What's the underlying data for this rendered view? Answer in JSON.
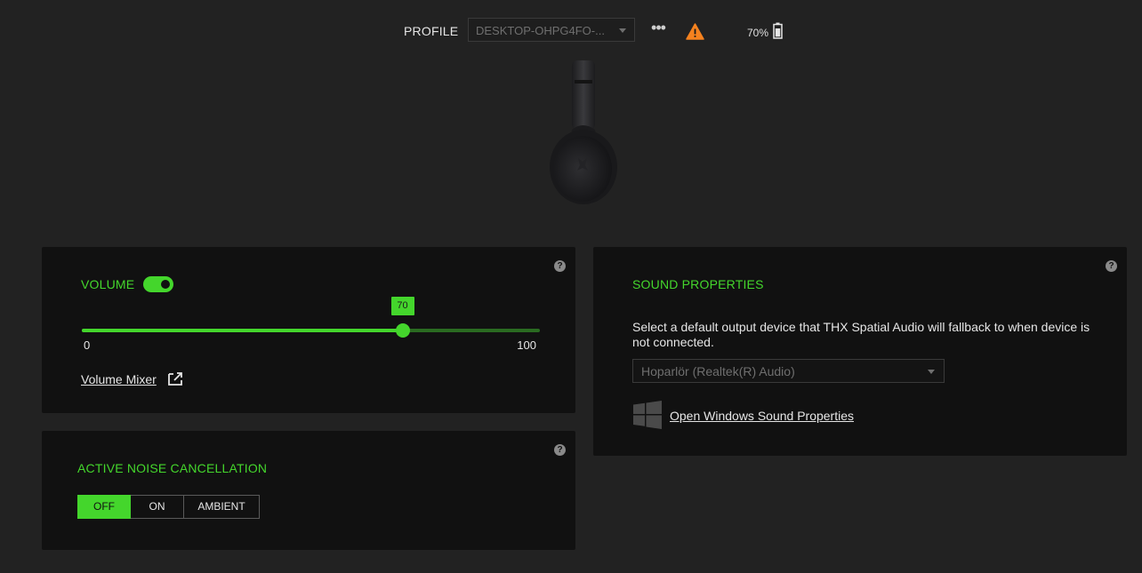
{
  "header": {
    "profile_label": "PROFILE",
    "profile_value": "DESKTOP-OHPG4FO-...",
    "more_label": "•••",
    "battery_text": "70%",
    "battery_level": 0.7
  },
  "volume": {
    "title": "VOLUME",
    "toggle_on": true,
    "value": 70,
    "value_label": "70",
    "min_label": "0",
    "max_label": "100",
    "mixer_link": "Volume Mixer"
  },
  "anc": {
    "title": "ACTIVE NOISE CANCELLATION",
    "options": [
      "OFF",
      "ON",
      "AMBIENT"
    ],
    "selected": "OFF"
  },
  "sound": {
    "title": "SOUND PROPERTIES",
    "description": "Select a default output device that THX Spatial Audio will fallback to when device is not connected.",
    "output_device": "Hoparlör (Realtek(R) Audio)",
    "windows_link": "Open Windows Sound Properties"
  },
  "help_glyph": "?",
  "colors": {
    "accent": "#44d62c",
    "warning": "#f5821f",
    "background": "#222222",
    "panel": "#111111"
  },
  "icons": {
    "more": "more-dots-icon",
    "warning": "warning-triangle-icon",
    "battery": "battery-icon",
    "external": "external-link-icon",
    "windows": "windows-logo-icon",
    "help": "help-icon"
  }
}
